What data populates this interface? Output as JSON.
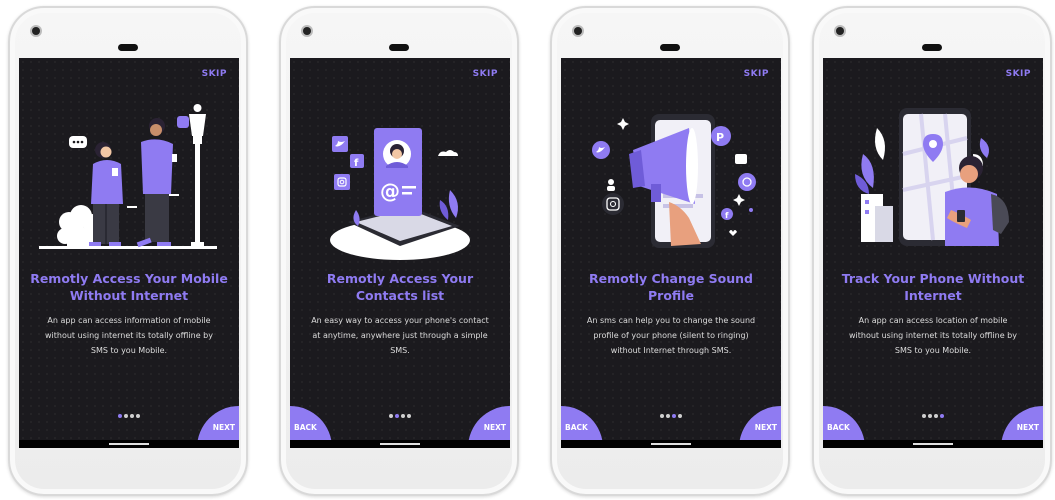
{
  "colors": {
    "accent": "#8f7bf2",
    "screen_bg": "#1b1a1e",
    "text": "#dcdcdc"
  },
  "screens": [
    {
      "skip_label": "SKIP",
      "title_line1": "Remotly Access Your Mobile",
      "title_line2": "Without Internet",
      "desc_line1": "An app can access information of mobile",
      "desc_line2": "without using internet its totally offline by",
      "desc_line3": "SMS to you Mobile.",
      "next_label": "NEXT",
      "illustration": "people-with-phones-street-lamp",
      "active_dot": 1,
      "dot_count": 4
    },
    {
      "skip_label": "SKIP",
      "title_line1": "Remotly Access Your",
      "title_line2": "Contacts list",
      "desc_line1": "An easy way to access your phone's contact",
      "desc_line2": "at anytime, anywhere just through a simple",
      "desc_line3": "SMS.",
      "back_label": "BACK",
      "next_label": "NEXT",
      "illustration": "tablet-with-contact-card-and-social-icons",
      "active_dot": 2,
      "dot_count": 4
    },
    {
      "skip_label": "SKIP",
      "title_line1": "Remotly Change Sound",
      "title_line2": "Profile",
      "desc_line1": "An sms can help you to change the sound",
      "desc_line2": "profile of your phone (silent to ringing)",
      "desc_line3": "without Internet through SMS.",
      "back_label": "BACK",
      "next_label": "NEXT",
      "illustration": "phone-with-megaphone",
      "active_dot": 3,
      "dot_count": 4
    },
    {
      "skip_label": "SKIP",
      "title_line1": "Track Your Phone Without",
      "title_line2": "Internet",
      "desc_line1": "An app can access location of mobile",
      "desc_line2": "without using internet its totally offline by",
      "desc_line3": "SMS to you Mobile.",
      "back_label": "BACK",
      "next_label": "NEXT",
      "illustration": "man-with-phone-and-map",
      "active_dot": 4,
      "dot_count": 4
    }
  ]
}
